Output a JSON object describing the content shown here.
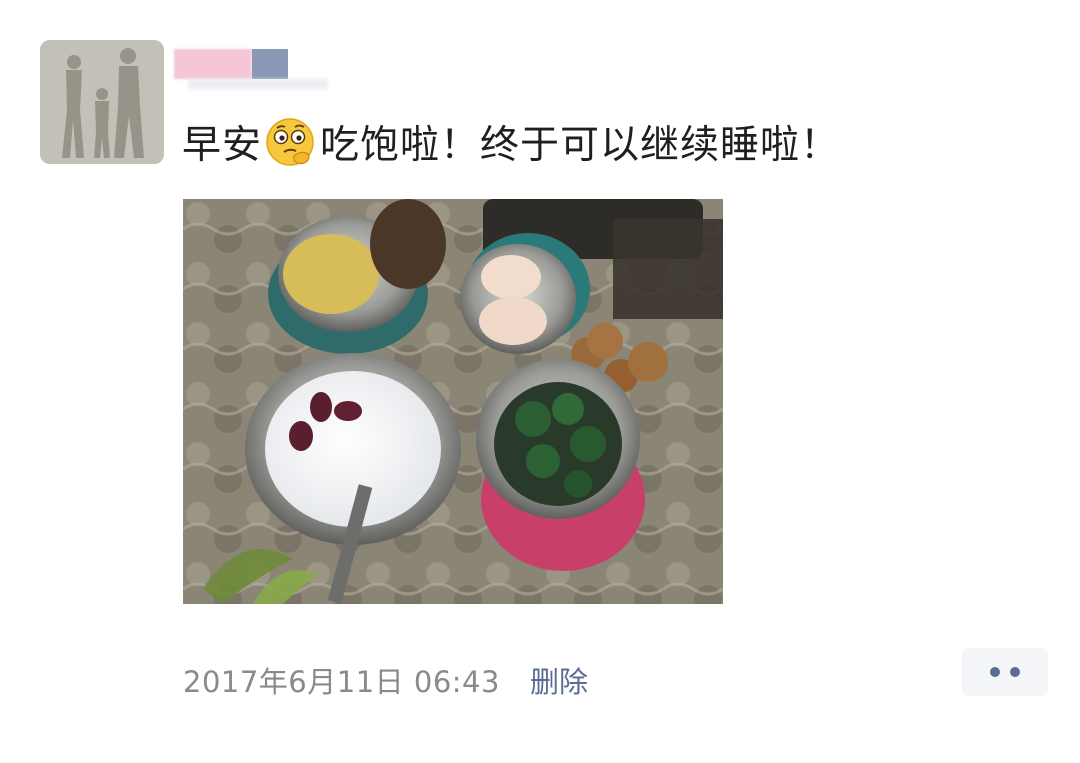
{
  "post": {
    "text_before_emoji": "早安",
    "emoji": "thinking-face-emoji",
    "text_after_emoji": "吃饱啦！终于可以继续睡啦！",
    "timestamp": "2017年6月11日 06:43",
    "delete_label": "删除"
  },
  "colors": {
    "text": "#1f1f1f",
    "timestamp": "#8a8a8a",
    "link": "#5b6b92",
    "more_button_bg": "#f4f5f8"
  },
  "icons": {
    "more": "more-dots-icon"
  }
}
